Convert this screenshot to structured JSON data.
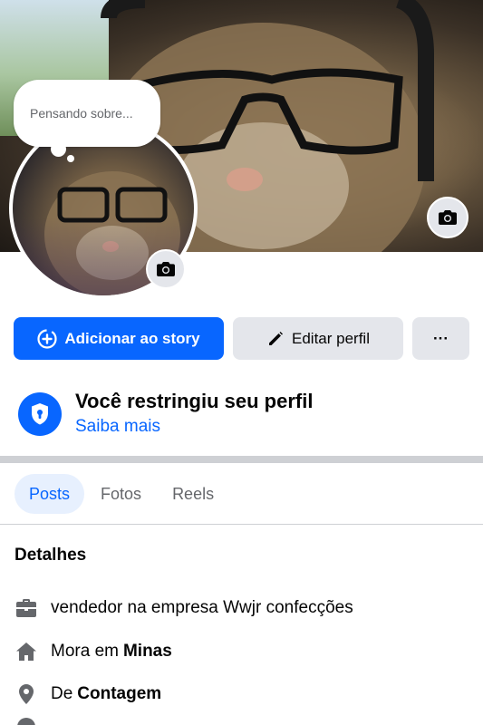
{
  "cover": {
    "camera_icon": "camera-icon"
  },
  "avatar": {
    "thought_bubble_text": "Pensando sobre...",
    "camera_icon": "camera-icon"
  },
  "actions": {
    "add_story_label": "Adicionar ao story",
    "add_story_icon": "plus-circle-icon",
    "edit_profile_label": "Editar perfil",
    "edit_profile_icon": "pencil-icon",
    "more_label": "···"
  },
  "restricted": {
    "icon": "shield-lock-icon",
    "title": "Você restringiu seu perfil",
    "link": "Saiba mais"
  },
  "tabs": [
    {
      "label": "Posts",
      "active": true
    },
    {
      "label": "Fotos",
      "active": false
    },
    {
      "label": "Reels",
      "active": false
    }
  ],
  "details": {
    "title": "Detalhes",
    "items": [
      {
        "icon": "briefcase-icon",
        "prefix": "vendedor na empresa Wwjr confecções",
        "bold": ""
      },
      {
        "icon": "home-icon",
        "prefix": "Mora em",
        "bold": "Minas"
      },
      {
        "icon": "location-pin-icon",
        "prefix": "De",
        "bold": "Contagem"
      }
    ]
  },
  "colors": {
    "primary": "#0866ff",
    "button_gray": "#e4e6eb",
    "text_secondary": "#65676b",
    "tab_active_bg": "#e7f0fe"
  }
}
